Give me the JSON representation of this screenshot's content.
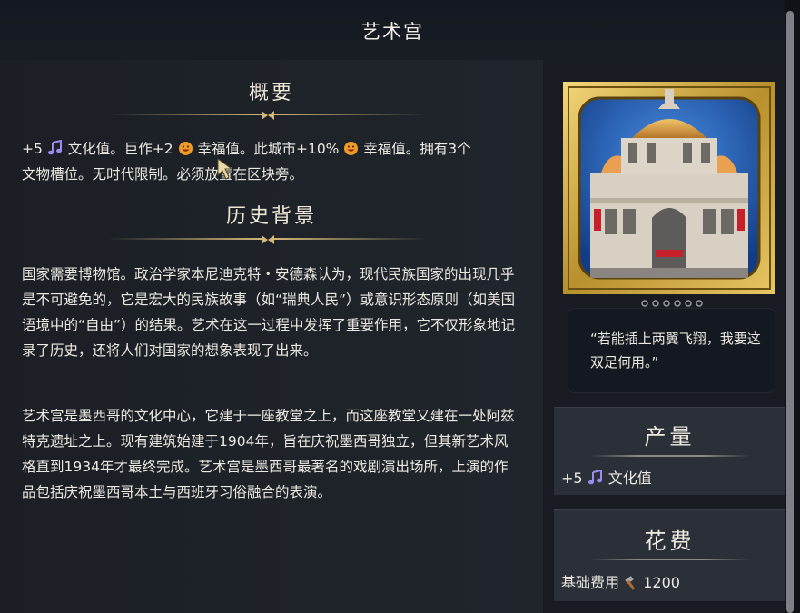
{
  "header": {
    "title": "艺术宫"
  },
  "overview": {
    "heading": "概要",
    "line1_a": "+5",
    "line1_b": "文化值。巨作+2",
    "line1_c": "幸福值。此城市+10%",
    "line1_d": "幸福值。拥有3个",
    "line2": "文物槽位。无时代限制。必须放置在区块旁。"
  },
  "history": {
    "heading": "历史背景",
    "para1": "国家需要博物馆。政治学家本尼迪克特・安德森认为，现代民族国家的出现几乎是不可避免的，它是宏大的民族故事（如“瑞典人民”）或意识形态原则（如美国语境中的“自由”）的结果。艺术在这一过程中发挥了重要作用，它不仅形象地记录了历史，还将人们对国家的想象表现了出来。",
    "para2": "艺术宫是墨西哥的文化中心，它建于一座教堂之上，而这座教堂又建在一处阿兹特克遗址之上。现有建筑始建于1904年，旨在庆祝墨西哥独立，但其新艺术风格直到1934年才最终完成。艺术宫是墨西哥最著名的戏剧演出场所，上演的作品包括庆祝墨西哥本土与西班牙习俗融合的表演。"
  },
  "quote": {
    "text": "“若能插上两翼飞翔，我要这双足何用。”"
  },
  "yield_box": {
    "title": "产量",
    "amount": "+5",
    "label": "文化值"
  },
  "cost_box": {
    "title": "花费",
    "label": "基础费用",
    "amount": "1200"
  },
  "icons": {
    "culture": "music-note-icon",
    "amenity": "smiley-face-icon",
    "production": "hammer-icon"
  },
  "colors": {
    "culture": "#9b8df0",
    "amenity": "#f09a2a",
    "gold_frame": "#c9a63c",
    "accent": "#d4b878"
  }
}
